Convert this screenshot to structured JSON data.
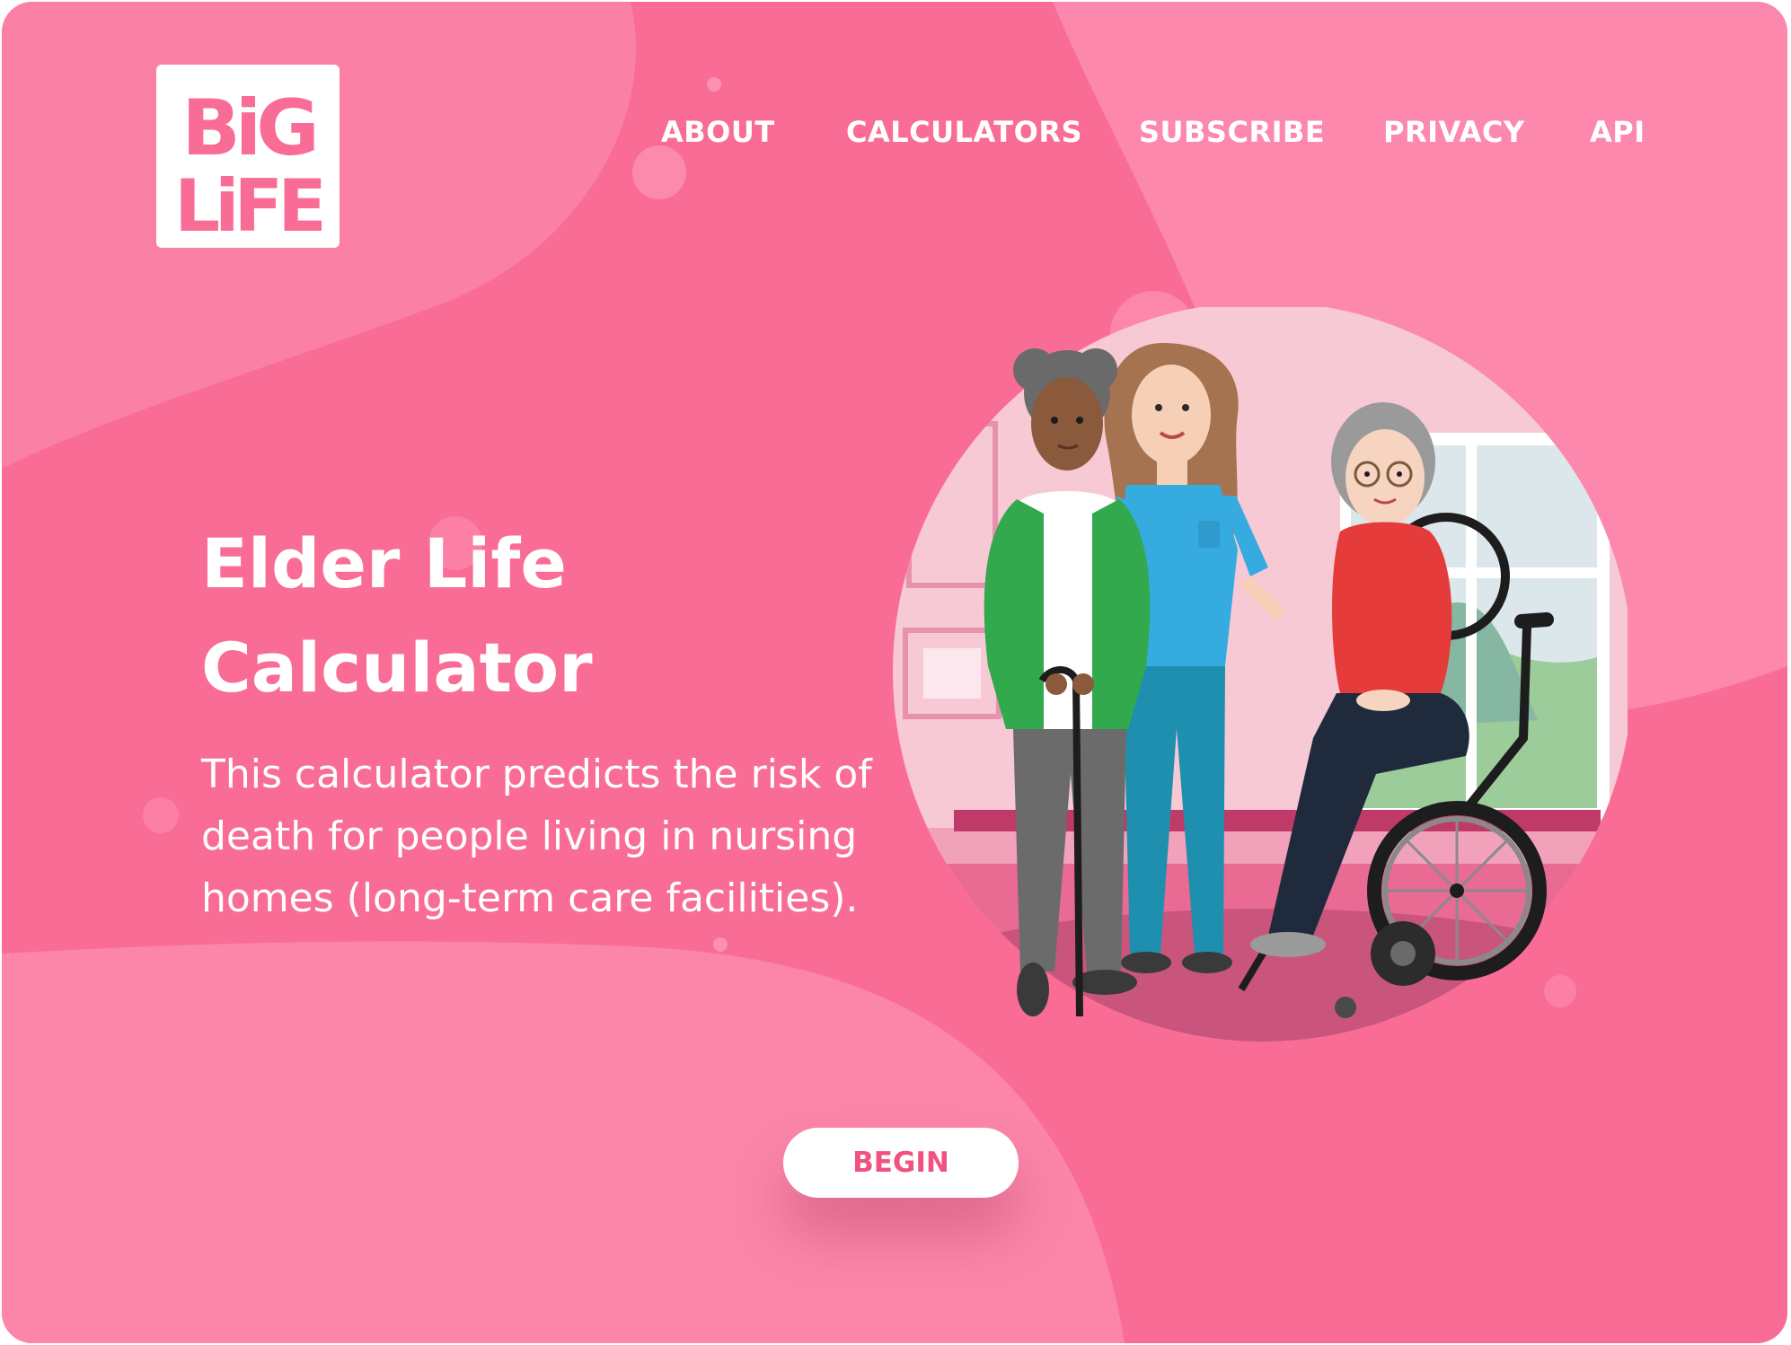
{
  "brand": {
    "logo_lines": [
      "BiG",
      "LiFE"
    ]
  },
  "nav": {
    "items": [
      "ABOUT",
      "CALCULATORS",
      "SUBSCRIBE",
      "PRIVACY",
      "API"
    ]
  },
  "hero": {
    "title_line1": "Elder Life",
    "title_line2": "Calculator",
    "description": "This calculator predicts the risk of death for people living in nursing homes (long-term care facilities).",
    "begin_label": "BEGIN"
  },
  "colors": {
    "background": "#f86c95",
    "blob_light": "#fb84a8",
    "button_text": "#f0517e",
    "text": "#ffffff"
  },
  "illustration": {
    "people": [
      "woman-with-cane",
      "nurse",
      "woman-in-wheelchair"
    ]
  }
}
